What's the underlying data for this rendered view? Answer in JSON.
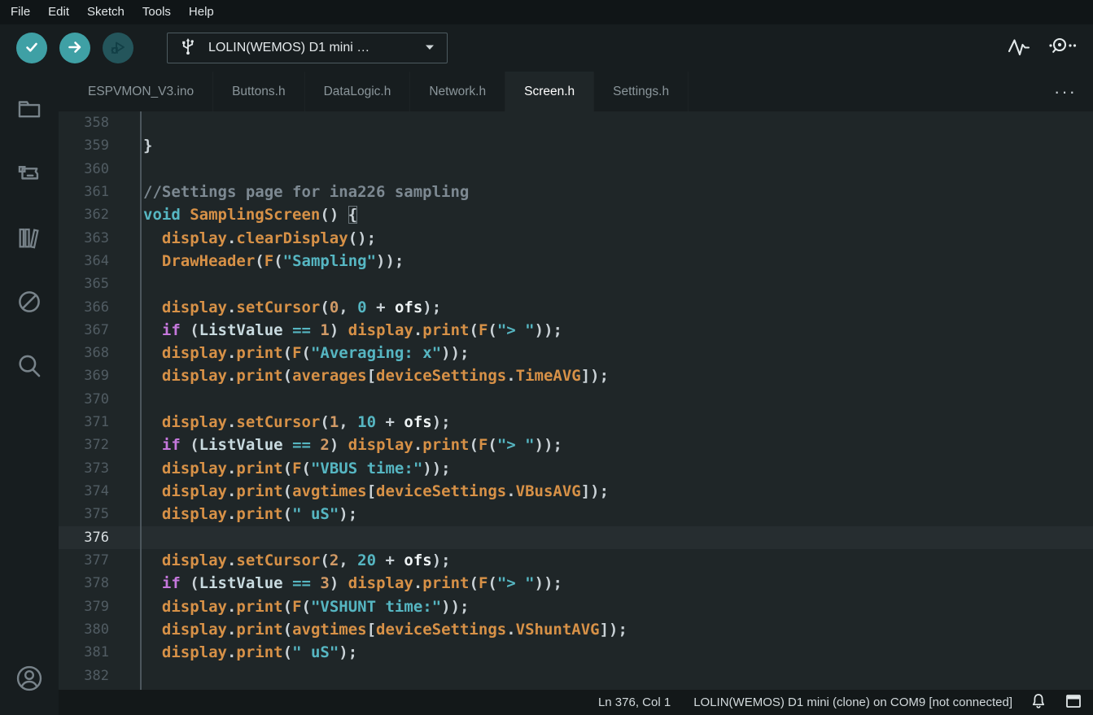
{
  "menubar": {
    "items": [
      "File",
      "Edit",
      "Sketch",
      "Tools",
      "Help"
    ]
  },
  "toolbar": {
    "verify_button": "verify",
    "upload_button": "upload",
    "debug_button": "debug (disabled)",
    "board_selector": {
      "label": "LOLIN(WEMOS) D1 mini …",
      "icon": "usb-icon",
      "caret": "caret-down-icon"
    },
    "right_icons": [
      "serial-plotter-icon",
      "serial-monitor-icon"
    ]
  },
  "tabs": [
    {
      "label": "ESPVMON_V3.ino",
      "active": false
    },
    {
      "label": "Buttons.h",
      "active": false
    },
    {
      "label": "DataLogic.h",
      "active": false
    },
    {
      "label": "Network.h",
      "active": false
    },
    {
      "label": "Screen.h",
      "active": true
    },
    {
      "label": "Settings.h",
      "active": false
    }
  ],
  "tabbar": {
    "more_label": "···"
  },
  "sidebar": {
    "items": [
      {
        "name": "sketchbook",
        "icon": "folder-icon"
      },
      {
        "name": "boards-manager",
        "icon": "board-icon"
      },
      {
        "name": "library-manager",
        "icon": "books-icon"
      },
      {
        "name": "debug",
        "icon": "debug-disabled-icon"
      },
      {
        "name": "search",
        "icon": "search-icon"
      }
    ],
    "bottom": {
      "name": "account",
      "icon": "account-icon"
    }
  },
  "editor": {
    "current_line": 376,
    "lines": [
      {
        "n": 358,
        "t": []
      },
      {
        "n": 359,
        "t": [
          [
            "pl",
            "}"
          ]
        ]
      },
      {
        "n": 360,
        "t": []
      },
      {
        "n": 361,
        "t": [
          [
            "cm",
            "//Settings page for ina226 sampling"
          ]
        ]
      },
      {
        "n": 362,
        "t": [
          [
            "ty",
            "void"
          ],
          [
            "pl",
            " "
          ],
          [
            "fn",
            "SamplingScreen"
          ],
          [
            "pl",
            "() "
          ],
          [
            "bx",
            "{"
          ]
        ]
      },
      {
        "n": 363,
        "t": [
          [
            "pl",
            "  "
          ],
          [
            "fn",
            "display"
          ],
          [
            "pl",
            "."
          ],
          [
            "fn",
            "clearDisplay"
          ],
          [
            "pl",
            "();"
          ]
        ]
      },
      {
        "n": 364,
        "t": [
          [
            "pl",
            "  "
          ],
          [
            "fn",
            "DrawHeader"
          ],
          [
            "pl",
            "("
          ],
          [
            "fn",
            "F"
          ],
          [
            "pl",
            "("
          ],
          [
            "st",
            "\"Sampling\""
          ],
          [
            "pl",
            "));"
          ]
        ]
      },
      {
        "n": 365,
        "t": []
      },
      {
        "n": 366,
        "t": [
          [
            "pl",
            "  "
          ],
          [
            "fn",
            "display"
          ],
          [
            "pl",
            "."
          ],
          [
            "fn",
            "setCursor"
          ],
          [
            "pl",
            "("
          ],
          [
            "nu",
            "0"
          ],
          [
            "pl",
            ", "
          ],
          [
            "nt",
            "0"
          ],
          [
            "pl",
            " + "
          ],
          [
            "vb",
            "ofs"
          ],
          [
            "pl",
            ");"
          ]
        ]
      },
      {
        "n": 367,
        "t": [
          [
            "pl",
            "  "
          ],
          [
            "kw",
            "if"
          ],
          [
            "pl",
            " ("
          ],
          [
            "va",
            "ListValue"
          ],
          [
            "pl",
            " "
          ],
          [
            "op",
            "=="
          ],
          [
            "pl",
            " "
          ],
          [
            "nu",
            "1"
          ],
          [
            "pl",
            ") "
          ],
          [
            "fn",
            "display"
          ],
          [
            "pl",
            "."
          ],
          [
            "fn",
            "print"
          ],
          [
            "pl",
            "("
          ],
          [
            "fn",
            "F"
          ],
          [
            "pl",
            "("
          ],
          [
            "st",
            "\"> \""
          ],
          [
            "pl",
            "));"
          ]
        ]
      },
      {
        "n": 368,
        "t": [
          [
            "pl",
            "  "
          ],
          [
            "fn",
            "display"
          ],
          [
            "pl",
            "."
          ],
          [
            "fn",
            "print"
          ],
          [
            "pl",
            "("
          ],
          [
            "fn",
            "F"
          ],
          [
            "pl",
            "("
          ],
          [
            "st",
            "\"Averaging: x\""
          ],
          [
            "pl",
            "));"
          ]
        ]
      },
      {
        "n": 369,
        "t": [
          [
            "pl",
            "  "
          ],
          [
            "fn",
            "display"
          ],
          [
            "pl",
            "."
          ],
          [
            "fn",
            "print"
          ],
          [
            "pl",
            "("
          ],
          [
            "fn",
            "averages"
          ],
          [
            "pl",
            "["
          ],
          [
            "fn",
            "deviceSettings"
          ],
          [
            "pl",
            "."
          ],
          [
            "fn",
            "TimeAVG"
          ],
          [
            "pl",
            "]);"
          ]
        ]
      },
      {
        "n": 370,
        "t": []
      },
      {
        "n": 371,
        "t": [
          [
            "pl",
            "  "
          ],
          [
            "fn",
            "display"
          ],
          [
            "pl",
            "."
          ],
          [
            "fn",
            "setCursor"
          ],
          [
            "pl",
            "("
          ],
          [
            "nu",
            "1"
          ],
          [
            "pl",
            ", "
          ],
          [
            "nt",
            "10"
          ],
          [
            "pl",
            " + "
          ],
          [
            "vb",
            "ofs"
          ],
          [
            "pl",
            ");"
          ]
        ]
      },
      {
        "n": 372,
        "t": [
          [
            "pl",
            "  "
          ],
          [
            "kw",
            "if"
          ],
          [
            "pl",
            " ("
          ],
          [
            "va",
            "ListValue"
          ],
          [
            "pl",
            " "
          ],
          [
            "op",
            "=="
          ],
          [
            "pl",
            " "
          ],
          [
            "nu",
            "2"
          ],
          [
            "pl",
            ") "
          ],
          [
            "fn",
            "display"
          ],
          [
            "pl",
            "."
          ],
          [
            "fn",
            "print"
          ],
          [
            "pl",
            "("
          ],
          [
            "fn",
            "F"
          ],
          [
            "pl",
            "("
          ],
          [
            "st",
            "\"> \""
          ],
          [
            "pl",
            "));"
          ]
        ]
      },
      {
        "n": 373,
        "t": [
          [
            "pl",
            "  "
          ],
          [
            "fn",
            "display"
          ],
          [
            "pl",
            "."
          ],
          [
            "fn",
            "print"
          ],
          [
            "pl",
            "("
          ],
          [
            "fn",
            "F"
          ],
          [
            "pl",
            "("
          ],
          [
            "st",
            "\"VBUS time:\""
          ],
          [
            "pl",
            "));"
          ]
        ]
      },
      {
        "n": 374,
        "t": [
          [
            "pl",
            "  "
          ],
          [
            "fn",
            "display"
          ],
          [
            "pl",
            "."
          ],
          [
            "fn",
            "print"
          ],
          [
            "pl",
            "("
          ],
          [
            "fn",
            "avgtimes"
          ],
          [
            "pl",
            "["
          ],
          [
            "fn",
            "deviceSettings"
          ],
          [
            "pl",
            "."
          ],
          [
            "fn",
            "VBusAVG"
          ],
          [
            "pl",
            "]);"
          ]
        ]
      },
      {
        "n": 375,
        "t": [
          [
            "pl",
            "  "
          ],
          [
            "fn",
            "display"
          ],
          [
            "pl",
            "."
          ],
          [
            "fn",
            "print"
          ],
          [
            "pl",
            "("
          ],
          [
            "st",
            "\" uS\""
          ],
          [
            "pl",
            ");"
          ]
        ]
      },
      {
        "n": 376,
        "t": []
      },
      {
        "n": 377,
        "t": [
          [
            "pl",
            "  "
          ],
          [
            "fn",
            "display"
          ],
          [
            "pl",
            "."
          ],
          [
            "fn",
            "setCursor"
          ],
          [
            "pl",
            "("
          ],
          [
            "nu",
            "2"
          ],
          [
            "pl",
            ", "
          ],
          [
            "nt",
            "20"
          ],
          [
            "pl",
            " + "
          ],
          [
            "vb",
            "ofs"
          ],
          [
            "pl",
            ");"
          ]
        ]
      },
      {
        "n": 378,
        "t": [
          [
            "pl",
            "  "
          ],
          [
            "kw",
            "if"
          ],
          [
            "pl",
            " ("
          ],
          [
            "va",
            "ListValue"
          ],
          [
            "pl",
            " "
          ],
          [
            "op",
            "=="
          ],
          [
            "pl",
            " "
          ],
          [
            "nu",
            "3"
          ],
          [
            "pl",
            ") "
          ],
          [
            "fn",
            "display"
          ],
          [
            "pl",
            "."
          ],
          [
            "fn",
            "print"
          ],
          [
            "pl",
            "("
          ],
          [
            "fn",
            "F"
          ],
          [
            "pl",
            "("
          ],
          [
            "st",
            "\"> \""
          ],
          [
            "pl",
            "));"
          ]
        ]
      },
      {
        "n": 379,
        "t": [
          [
            "pl",
            "  "
          ],
          [
            "fn",
            "display"
          ],
          [
            "pl",
            "."
          ],
          [
            "fn",
            "print"
          ],
          [
            "pl",
            "("
          ],
          [
            "fn",
            "F"
          ],
          [
            "pl",
            "("
          ],
          [
            "st",
            "\"VSHUNT time:\""
          ],
          [
            "pl",
            "));"
          ]
        ]
      },
      {
        "n": 380,
        "t": [
          [
            "pl",
            "  "
          ],
          [
            "fn",
            "display"
          ],
          [
            "pl",
            "."
          ],
          [
            "fn",
            "print"
          ],
          [
            "pl",
            "("
          ],
          [
            "fn",
            "avgtimes"
          ],
          [
            "pl",
            "["
          ],
          [
            "fn",
            "deviceSettings"
          ],
          [
            "pl",
            "."
          ],
          [
            "fn",
            "VShuntAVG"
          ],
          [
            "pl",
            "]);"
          ]
        ]
      },
      {
        "n": 381,
        "t": [
          [
            "pl",
            "  "
          ],
          [
            "fn",
            "display"
          ],
          [
            "pl",
            "."
          ],
          [
            "fn",
            "print"
          ],
          [
            "pl",
            "("
          ],
          [
            "st",
            "\" uS\""
          ],
          [
            "pl",
            ");"
          ]
        ]
      },
      {
        "n": 382,
        "t": []
      }
    ]
  },
  "statusbar": {
    "position": "Ln 376, Col 1",
    "board_status": "LOLIN(WEMOS) D1 mini (clone) on COM9 [not connected]",
    "icons": [
      "bell-icon",
      "panel-toggle-icon"
    ]
  },
  "colors": {
    "accent_teal": "#3fa0a5",
    "keyword_purple": "#c678dd",
    "type_teal": "#56b6c2",
    "string_teal": "#56b6c2",
    "identifier_orange": "#d79147",
    "number_orange": "#d19a66",
    "comment_gray": "#7d8992",
    "editor_bg": "#1f2628",
    "chrome_bg": "#171d1f"
  }
}
